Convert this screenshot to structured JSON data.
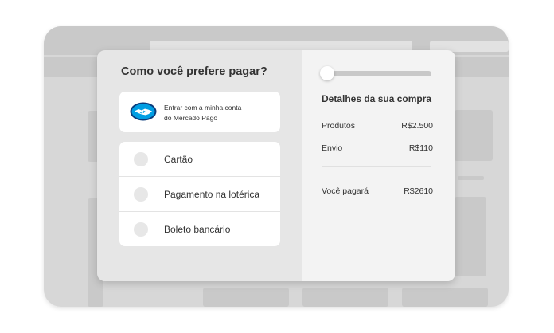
{
  "payment": {
    "title": "Como você prefere pagar?",
    "mercado_pago": {
      "line1": "Entrar com a minha conta",
      "line2": "do Mercado Pago"
    },
    "options": [
      {
        "label": "Cartão"
      },
      {
        "label": "Pagamento na lotérica"
      },
      {
        "label": "Boleto bancário"
      }
    ]
  },
  "summary": {
    "title": "Detalhes da sua compra",
    "products_label": "Produtos",
    "products_value": "R$2.500",
    "shipping_label": "Envio",
    "shipping_value": "R$110",
    "total_label": "Você pagará",
    "total_value": "R$2610"
  },
  "colors": {
    "mercado_pago_blue": "#009ee3",
    "mercado_pago_navy": "#0b3c7c"
  }
}
